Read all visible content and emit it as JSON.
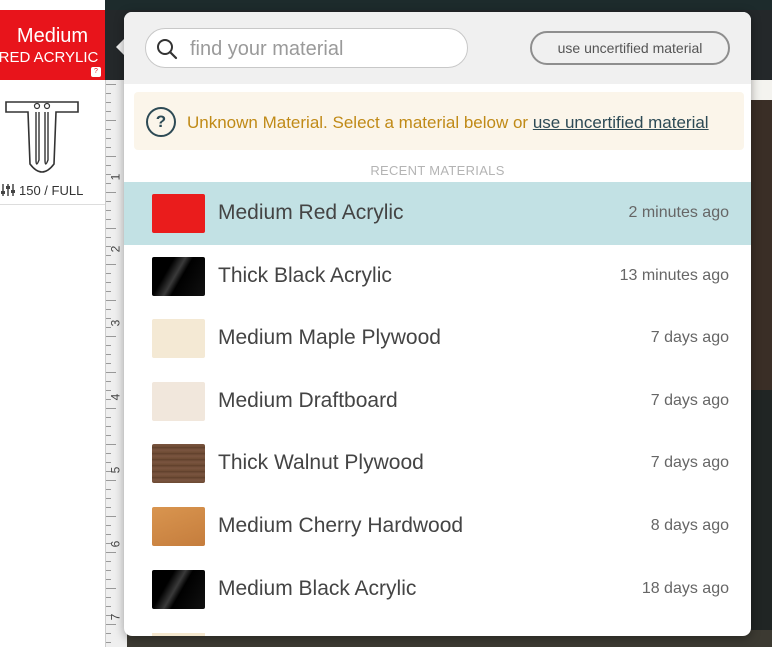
{
  "left_panel": {
    "material_badge": {
      "line1": "Medium",
      "line2": "RED ACRYLIC",
      "help": "?",
      "color": "#e8141b"
    },
    "power_setting": "150 / FULL",
    "ruler_numbers": [
      "1",
      "2",
      "3",
      "4",
      "5",
      "6",
      "7"
    ]
  },
  "popup": {
    "search": {
      "placeholder": "find your material",
      "value": ""
    },
    "uncertified_button_label": "use uncertified material",
    "warning": {
      "icon": "question-circle-icon",
      "text": "Unknown Material. Select a material below or ",
      "link_text": "use uncertified material"
    },
    "section_label": "RECENT MATERIALS",
    "materials": [
      {
        "name": "Medium Red Acrylic",
        "time": "2 minutes ago",
        "selected": true,
        "swatch": "#ea1c1c"
      },
      {
        "name": "Thick Black Acrylic",
        "time": "13 minutes ago",
        "selected": false,
        "swatch": "#111111"
      },
      {
        "name": "Medium Maple Plywood",
        "time": "7 days ago",
        "selected": false,
        "swatch": "#f4e9d4"
      },
      {
        "name": "Medium Draftboard",
        "time": "7 days ago",
        "selected": false,
        "swatch": "#f1e7dc"
      },
      {
        "name": "Thick Walnut Plywood",
        "time": "7 days ago",
        "selected": false,
        "swatch": "#6d4a33"
      },
      {
        "name": "Medium Cherry Hardwood",
        "time": "8 days ago",
        "selected": false,
        "swatch": "#cf8a4a"
      },
      {
        "name": "Medium Black Acrylic",
        "time": "18 days ago",
        "selected": false,
        "swatch": "#0f0f0f"
      }
    ]
  },
  "colors": {
    "selected_row": "#c2e1e4",
    "warning_text": "#c08a17",
    "link": "#2d4a55"
  }
}
